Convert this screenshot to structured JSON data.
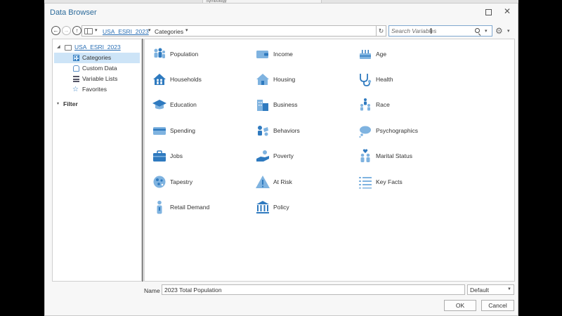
{
  "window": {
    "title": "Data Browser",
    "background_tab": "Symbology"
  },
  "toolbar": {
    "breadcrumb_root": "USA_ESRI_2023",
    "breadcrumb_current": "Categories",
    "search_placeholder": "Search Variables"
  },
  "sidebar": {
    "root": "USA_ESRI_2023",
    "items": [
      {
        "label": "Categories",
        "icon": "grid-icon",
        "selected": true
      },
      {
        "label": "Custom Data",
        "icon": "database-icon",
        "selected": false
      },
      {
        "label": "Variable Lists",
        "icon": "list-icon",
        "selected": false
      },
      {
        "label": "Favorites",
        "icon": "star-icon",
        "selected": false
      }
    ],
    "filter_label": "Filter"
  },
  "categories": [
    {
      "label": "Population",
      "icon": "people-icon"
    },
    {
      "label": "Income",
      "icon": "wallet-icon"
    },
    {
      "label": "Age",
      "icon": "birthday-cake-icon"
    },
    {
      "label": "Households",
      "icon": "households-icon"
    },
    {
      "label": "Housing",
      "icon": "house-icon"
    },
    {
      "label": "Health",
      "icon": "stethoscope-icon"
    },
    {
      "label": "Education",
      "icon": "graduation-cap-icon"
    },
    {
      "label": "Business",
      "icon": "buildings-icon"
    },
    {
      "label": "Race",
      "icon": "race-people-icon"
    },
    {
      "label": "Spending",
      "icon": "credit-card-icon"
    },
    {
      "label": "Behaviors",
      "icon": "behaviors-icon"
    },
    {
      "label": "Psychographics",
      "icon": "head-cloud-icon"
    },
    {
      "label": "Jobs",
      "icon": "briefcase-icon"
    },
    {
      "label": "Poverty",
      "icon": "hand-coin-icon"
    },
    {
      "label": "Marital Status",
      "icon": "couple-heart-icon"
    },
    {
      "label": "Tapestry",
      "icon": "tapestry-globe-icon"
    },
    {
      "label": "At Risk",
      "icon": "warning-icon"
    },
    {
      "label": "Key Facts",
      "icon": "key-facts-list-icon"
    },
    {
      "label": "Retail Demand",
      "icon": "retail-person-icon"
    },
    {
      "label": "Policy",
      "icon": "capitol-building-icon"
    }
  ],
  "footer": {
    "name_label": "Name",
    "name_value": "2023 Total Population",
    "style_value": "Default",
    "ok_label": "OK",
    "cancel_label": "Cancel"
  },
  "colors": {
    "accent": "#2f7abf",
    "icon_light": "#7fb3e0",
    "selected_bg": "#cde4f7",
    "title": "#2b6a9a"
  }
}
